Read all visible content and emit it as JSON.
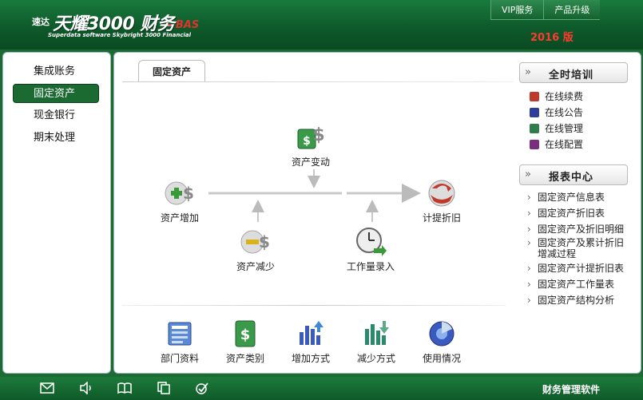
{
  "header": {
    "logo_small": "速达",
    "logo_main": "天耀3000 财务",
    "logo_suffix": "- BAS",
    "logo_sub": "Superdata software Skybright 3000 Financial",
    "version": "2016 版",
    "nav": [
      {
        "label": "VIP服务"
      },
      {
        "label": "产品升级"
      }
    ]
  },
  "sidebar": {
    "items": [
      {
        "label": "集成账务",
        "active": false
      },
      {
        "label": "固定资产",
        "active": true
      },
      {
        "label": "现金银行",
        "active": false
      },
      {
        "label": "期末处理",
        "active": false
      }
    ]
  },
  "main": {
    "tab_label": "固定资产",
    "flow": {
      "asset_change": "资产变动",
      "asset_add": "资产增加",
      "asset_reduce": "资产减少",
      "workload_entry": "工作量录入",
      "depreciation": "计提折旧"
    },
    "tools": [
      {
        "label": "部门资料",
        "icon": "department-icon"
      },
      {
        "label": "资产类别",
        "icon": "asset-category-icon"
      },
      {
        "label": "增加方式",
        "icon": "add-method-icon"
      },
      {
        "label": "减少方式",
        "icon": "reduce-method-icon"
      },
      {
        "label": "使用情况",
        "icon": "usage-icon"
      }
    ]
  },
  "training": {
    "chevron": "»",
    "title": "全时培训",
    "items": [
      {
        "label": "在线续费",
        "color": "#c0392b"
      },
      {
        "label": "在线公告",
        "color": "#2c3e9a"
      },
      {
        "label": "在线管理",
        "color": "#2e7d4a"
      },
      {
        "label": "在线配置",
        "color": "#7a2e7d"
      }
    ]
  },
  "reports": {
    "chevron": "»",
    "arrow": "›",
    "title": "报表中心",
    "items": [
      {
        "label": "固定资产信息表"
      },
      {
        "label": "固定资产折旧表"
      },
      {
        "label": "固定资产及折旧明细"
      },
      {
        "label": "固定资产及累计折旧增减过程"
      },
      {
        "label": "固定资产计提折旧表"
      },
      {
        "label": "固定资产工作量表"
      },
      {
        "label": "固定资产结构分析"
      }
    ]
  },
  "footer": {
    "text": "财务管理软件",
    "icons": [
      "mail-icon",
      "speaker-icon",
      "book-icon",
      "copy-icon",
      "check-icon"
    ]
  },
  "colors": {
    "brand_green": "#1b6a32",
    "accent_red": "#ff3b30"
  }
}
